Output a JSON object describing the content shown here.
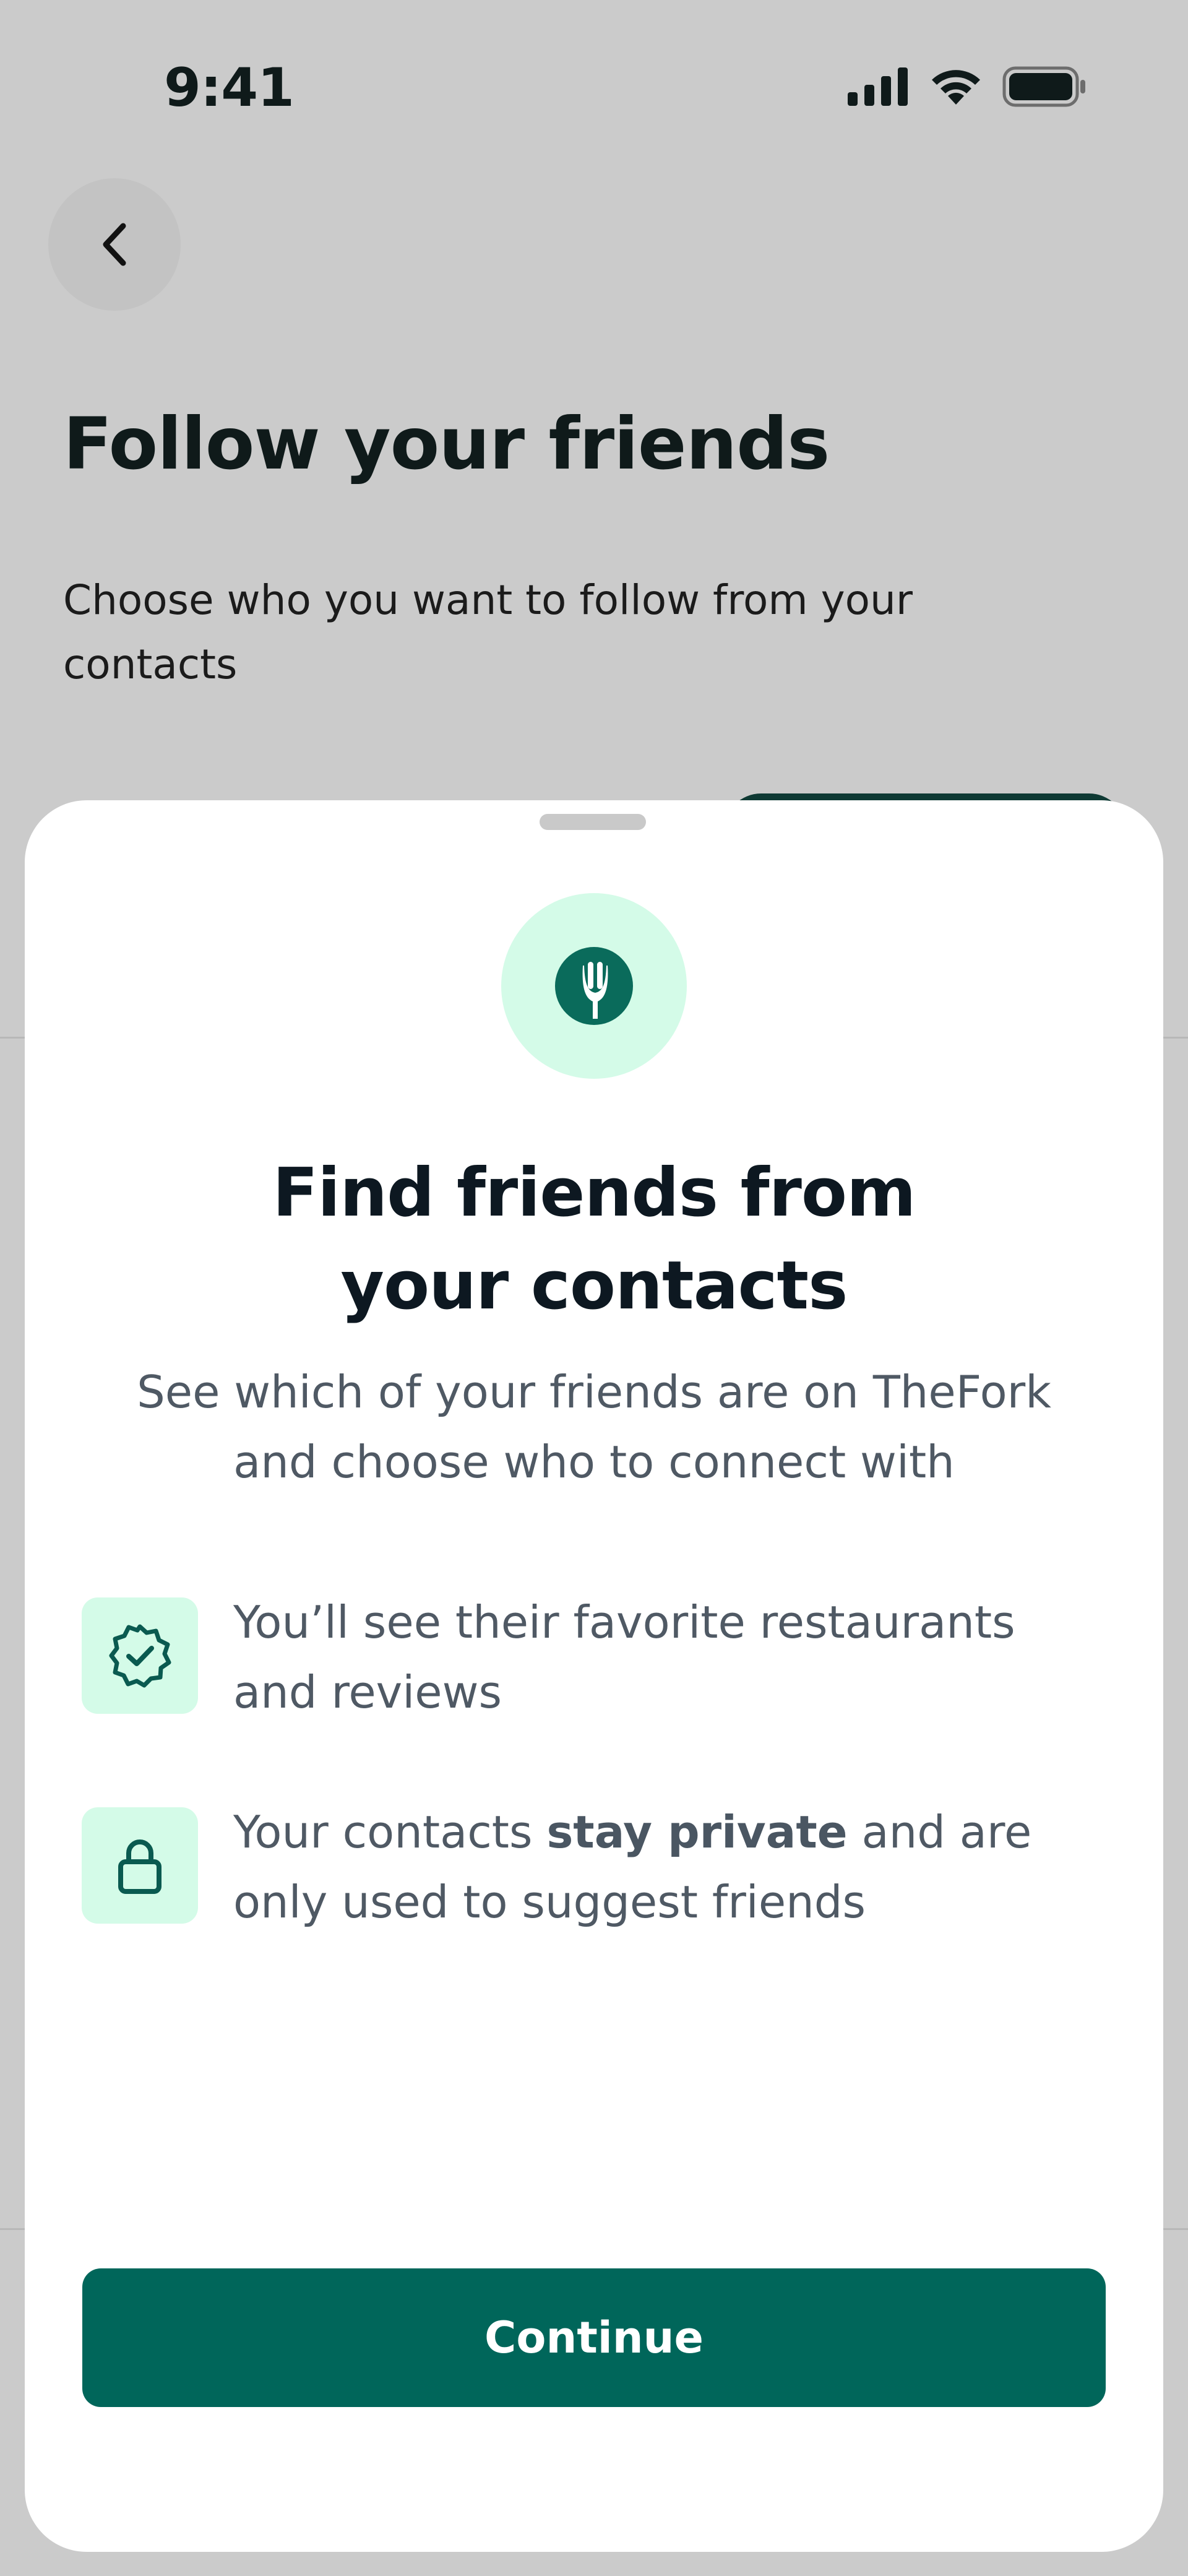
{
  "status_bar": {
    "time": "9:41"
  },
  "background_screen": {
    "title": "Follow your friends",
    "subtitle": "Choose who you want to follow from your contacts"
  },
  "sheet": {
    "title_line_1": "Find friends from",
    "title_line_2": "your contacts",
    "description": "See which of your friends are on TheFork and choose who to connect with",
    "features": [
      {
        "icon": "verified-badge-icon",
        "text": "You’ll see their favorite restaurants and reviews"
      },
      {
        "icon": "lock-icon",
        "text_before": "Your contacts ",
        "text_bold": "stay private",
        "text_after": " and are only used to suggest friends"
      }
    ],
    "continue_label": "Continue"
  },
  "colors": {
    "brand_dark_green": "#00665a",
    "brand_mint": "#d4fbe8",
    "logo_green": "#0a6b5b",
    "overlay_gray": "#cbcbcb"
  }
}
